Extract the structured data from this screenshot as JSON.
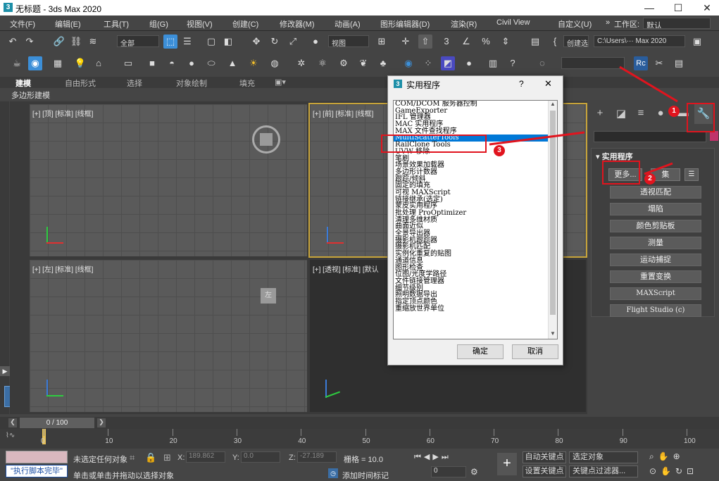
{
  "window": {
    "title": "无标题 - 3ds Max 2020",
    "app_icon": "3",
    "minimize": "—",
    "maximize": "☐",
    "close": "✕"
  },
  "menu": [
    "文件(F)",
    "编辑(E)",
    "工具(T)",
    "组(G)",
    "视图(V)",
    "创建(C)",
    "修改器(M)",
    "动画(A)",
    "图形编辑器(D)",
    "渲染(R)",
    "Civil View",
    "自定义(U)",
    "»",
    "工作区:",
    "默认"
  ],
  "toolbar": {
    "selection_filter": "全部",
    "ref_coord": "视图",
    "create_selection_set": "创建选",
    "project_path": "C:\\Users\\··· Max 2020"
  },
  "ribbon": {
    "tabs": [
      "建模",
      "自由形式",
      "选择",
      "对象绘制",
      "填充"
    ],
    "sub": "多边形建模"
  },
  "viewports": {
    "top": "[+] [顶] [标准] [线框]",
    "front": "[+] [前] [标准] [线框]",
    "left": "[+] [左] [标准] [线框]",
    "persp": "[+] [透视] [标准] [默认",
    "left_cube_label": "左"
  },
  "utilities": {
    "title": "实用程序",
    "more_btn": "更多...",
    "sets_btn": "集",
    "buttons": [
      "透视匹配",
      "塌陷",
      "颜色剪贴板",
      "测量",
      "运动捕捉",
      "重置变换",
      "MAXScript",
      "Flight Studio (c)"
    ]
  },
  "dialog": {
    "title": "实用程序",
    "help": "?",
    "close": "✕",
    "items": [
      "COM/DCOM 服务器控制",
      "GameExporter",
      "IFL 管理器",
      "MAC 实用程序",
      "MAX 文件查找程序",
      "MultiScatterTools",
      "RailClone Tools",
      "UVW 移除",
      "笔刷",
      "场景效果加载器",
      "多边形计数器",
      "跟踪/倾斜",
      "固定的填充",
      "可视 MAXScript",
      "链接继承(选定)",
      "蒙皮实用程序",
      "批处理 ProOptimizer",
      "清理多维材质",
      "曲面近似",
      "全景导出器",
      "摄影机跟踪器",
      "摄影机匹配",
      "实例化重复的贴图",
      "通道信息",
      "图形检查",
      "位图/光度学路径",
      "文件链接管理器",
      "细节级别",
      "照明数据导出",
      "指定顶点颜色",
      "重缩放世界单位"
    ],
    "selected_index": 5,
    "ok": "确定",
    "cancel": "取消"
  },
  "annotations": [
    "1",
    "2",
    "3"
  ],
  "timeline": {
    "frame": "0 / 100",
    "ticks": [
      "0",
      "10",
      "20",
      "30",
      "40",
      "50",
      "60",
      "70",
      "80",
      "90",
      "100"
    ]
  },
  "status": {
    "selection": "未选定任何对象",
    "prompt": "单击或单击并拖动以选择对象",
    "script": "\"执行脚本完毕\"",
    "x_label": "X:",
    "x": "189.862",
    "y_label": "Y:",
    "y": "0.0",
    "z_label": "Z:",
    "z": "-27.189",
    "grid": "栅格 = 10.0",
    "add_time_tag": "添加时间标记",
    "auto_key": "自动关键点",
    "set_key": "设置关键点",
    "selected_obj": "选定对象",
    "key_filters": "关键点过滤器...",
    "frame": "0"
  },
  "colors": {
    "accent_red": "#e1141e",
    "selection_blue": "#0078d7",
    "ui_dark": "#444444"
  }
}
